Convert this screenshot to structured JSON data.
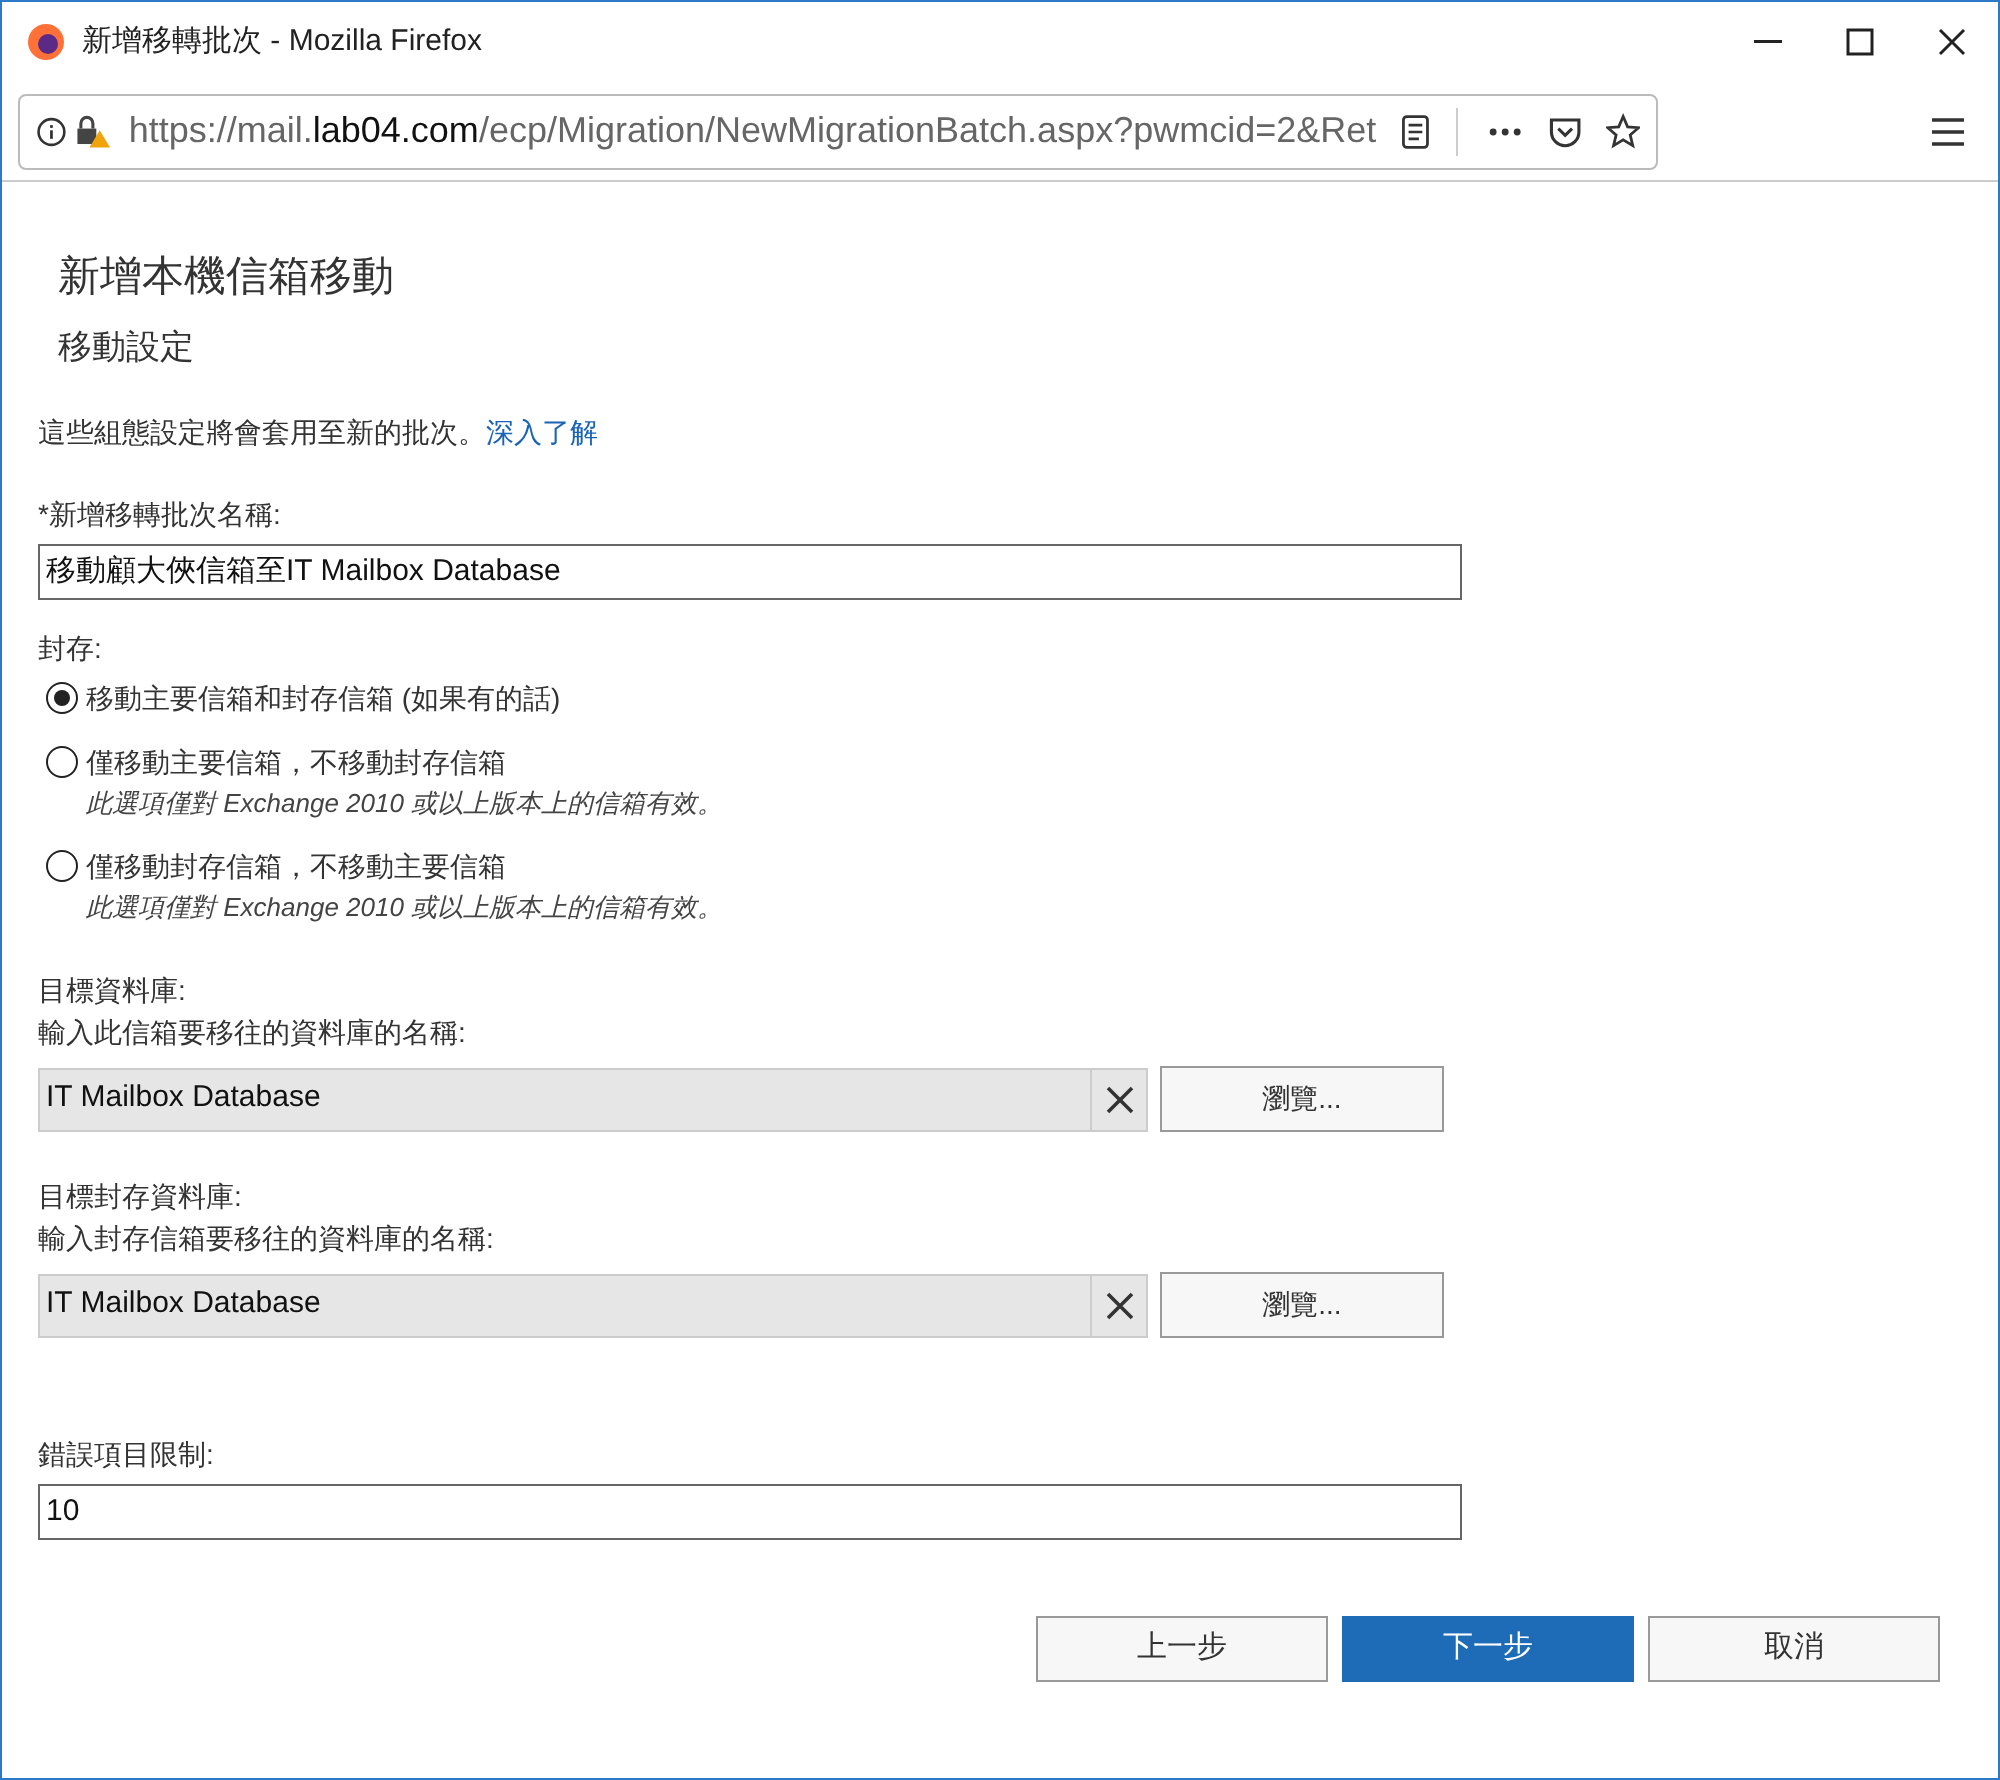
{
  "window": {
    "title": "新增移轉批次 - Mozilla Firefox"
  },
  "address_bar": {
    "url_parts": [
      {
        "text": "https://mail.",
        "emphasis": false
      },
      {
        "text": "lab04.com",
        "emphasis": true
      },
      {
        "text": "/ecp/Migration/NewMigrationBatch.aspx?pwmcid=2&Ret",
        "emphasis": false
      }
    ]
  },
  "page": {
    "title": "新增本機信箱移動",
    "subtitle": "移動設定",
    "intro": "這些組態設定將會套用至新的批次。",
    "intro_link": "深入了解",
    "batch_name": {
      "label": "*新增移轉批次名稱:",
      "value": "移動顧大俠信箱至IT Mailbox Database"
    },
    "archive": {
      "label": "封存:",
      "options": [
        {
          "label": "移動主要信箱和封存信箱 (如果有的話)",
          "selected": true
        },
        {
          "label": "僅移動主要信箱，不移動封存信箱",
          "note": "此選項僅對 Exchange 2010 或以上版本上的信箱有效。",
          "selected": false
        },
        {
          "label": "僅移動封存信箱，不移動主要信箱",
          "note": "此選項僅對 Exchange 2010 或以上版本上的信箱有效。",
          "selected": false
        }
      ]
    },
    "databases": [
      {
        "label": "目標資料庫:",
        "hint": "輸入此信箱要移往的資料庫的名稱:",
        "value": "IT Mailbox Database",
        "browse": "瀏覽..."
      },
      {
        "label": "目標封存資料庫:",
        "hint": "輸入封存信箱要移往的資料庫的名稱:",
        "value": "IT Mailbox Database",
        "browse": "瀏覽..."
      }
    ],
    "error_limit": {
      "label": "錯誤項目限制:",
      "value": "10"
    },
    "buttons": [
      {
        "label": "上一步",
        "kind": "secondary"
      },
      {
        "label": "下一步",
        "kind": "primary"
      },
      {
        "label": "取消",
        "kind": "secondary"
      }
    ]
  }
}
